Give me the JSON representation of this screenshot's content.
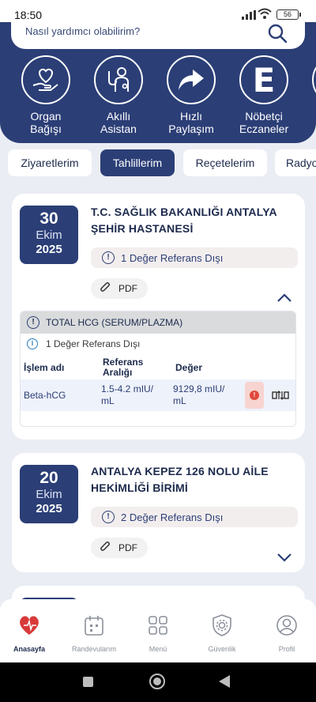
{
  "status_bar": {
    "time": "18:50",
    "battery": "56"
  },
  "search": {
    "placeholder": "Nasıl yardımcı olabilirim?"
  },
  "quick_actions": [
    {
      "label": "Organ\nBağışı",
      "icon": "hand-heart-icon"
    },
    {
      "label": "Akıllı\nAsistan",
      "icon": "doctor-icon"
    },
    {
      "label": "Hızlı\nPaylaşım",
      "icon": "share-arrow-icon"
    },
    {
      "label": "Nöbetçi\nEczaneler",
      "icon": "pharmacy-e-icon",
      "letter": "E"
    }
  ],
  "tabs": [
    "Ziyaretlerim",
    "Tahlillerim",
    "Reçetelerim",
    "Radyo"
  ],
  "active_tab": "Tahlillerim",
  "cards": [
    {
      "day": "30",
      "month": "Ekim",
      "year": "2025",
      "hospital": "T.C. SAĞLIK BAKANLIĞI ANTALYA ŞEHİR HASTANESİ",
      "alert": "1 Değer Referans Dışı",
      "pdf_label": "PDF",
      "expanded": {
        "test_name": "TOTAL HCG (SERUM/PLAZMA)",
        "sub_alert": "1 Değer Referans Dışı",
        "columns": {
          "name": "İşlem adı",
          "range": "Referans\nAralığı",
          "value": "Değer"
        },
        "rows": [
          {
            "name": "Beta-hCG",
            "range": "1.5-4.2 mIU/\nmL",
            "value": "9129,8 mIU/\nmL"
          }
        ]
      }
    },
    {
      "day": "20",
      "month": "Ekim",
      "year": "2025",
      "hospital": "ANTALYA KEPEZ 126 NOLU AİLE HEKİMLİĞİ BİRİMİ",
      "alert": "2 Değer Referans Dışı",
      "pdf_label": "PDF"
    }
  ],
  "bottom_nav": [
    {
      "label": "Anasayfa",
      "icon": "heart-home-icon",
      "active": true
    },
    {
      "label": "Randevularım",
      "icon": "calendar-icon",
      "active": false
    },
    {
      "label": "Menü",
      "icon": "grid-menu-icon",
      "active": false
    },
    {
      "label": "Güvenlik",
      "icon": "shield-gear-icon",
      "active": false
    },
    {
      "label": "Profil",
      "icon": "user-icon",
      "active": false
    }
  ],
  "colors": {
    "primary": "#2b3e76",
    "warning": "#e0483a",
    "background": "#eaedf3"
  }
}
